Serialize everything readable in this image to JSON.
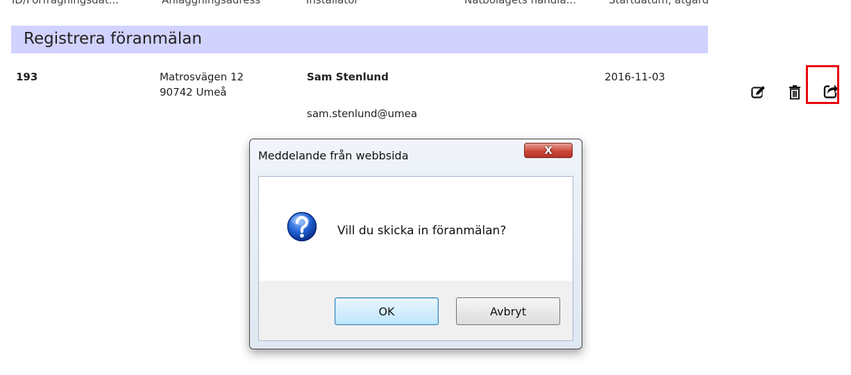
{
  "table": {
    "columns": [
      "ID/Förfrågningsdat...",
      "Anläggningsadress",
      "Installatör",
      "Nätbolagets handlä...",
      "Startdatum, åtgärd"
    ]
  },
  "section": {
    "title": "Registrera föranmälan"
  },
  "row": {
    "id": "193",
    "address_line1": "Matrosvägen 12",
    "address_line2": "90742 Umeå",
    "installer_name": "Sam Stenlund",
    "installer_email": "sam.stenlund@umea",
    "start_date": "2016-11-03",
    "actions": [
      "edit-icon",
      "delete-icon",
      "send-icon"
    ]
  },
  "dialog": {
    "title": "Meddelande från webbsida",
    "close_label": "X",
    "message": "Vill du skicka in föranmälan?",
    "icon": "question-icon",
    "ok_label": "OK",
    "cancel_label": "Avbryt"
  },
  "colors": {
    "section_bar": "#d2d2ff",
    "highlight": "#e8000c",
    "ok_accent": "#3c7fb1"
  }
}
